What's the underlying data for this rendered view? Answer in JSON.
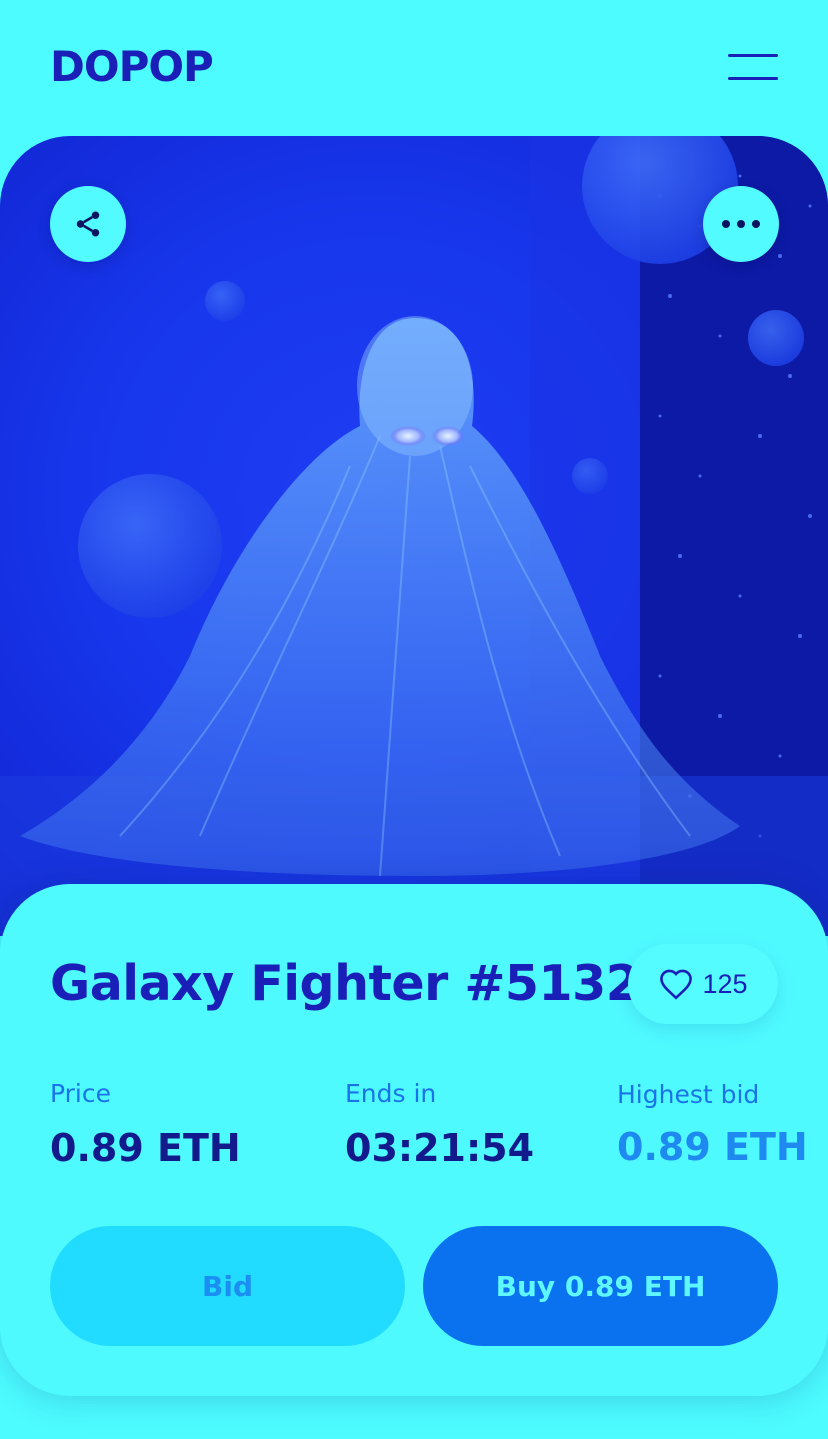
{
  "header": {
    "logo": "DOPOP"
  },
  "item": {
    "title": "Galaxy Fighter #5132",
    "likes": "125"
  },
  "stats": {
    "price_label": "Price",
    "price_value": "0.89 ETH",
    "ends_label": "Ends in",
    "ends_value": "03:21:54",
    "bid_label": "Highest bid",
    "bid_value": "0.89 ETH"
  },
  "actions": {
    "bid_label": "Bid",
    "buy_label": "Buy 0.89 ETH"
  },
  "icons": {
    "share": "share-icon",
    "more": "more-icon",
    "heart": "heart-icon",
    "menu": "hamburger-menu-icon"
  },
  "colors": {
    "background": "#4dfcff",
    "brand": "#1a1fb8",
    "accent": "#0a72ef",
    "secondary_button": "#22dcff"
  }
}
